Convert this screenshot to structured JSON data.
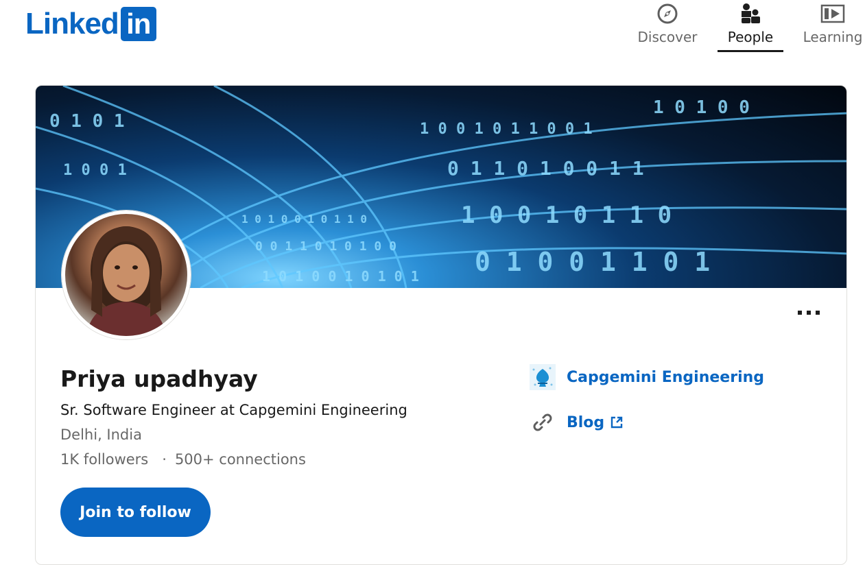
{
  "brand": {
    "logo_word": "Linked",
    "logo_box": "in",
    "color": "#0a66c2"
  },
  "nav": {
    "items": [
      {
        "label": "Discover",
        "icon": "compass-icon",
        "active": false
      },
      {
        "label": "People",
        "icon": "people-icon",
        "active": true
      },
      {
        "label": "Learning",
        "icon": "video-icon",
        "active": false
      }
    ]
  },
  "profile": {
    "name": "Priya upadhyay",
    "headline": "Sr. Software Engineer at Capgemini Engineering",
    "location": "Delhi, India",
    "followers": "1K followers",
    "separator": "·",
    "connections": "500+ connections",
    "cta_label": "Join to follow",
    "more_icon": "more-horizontal-icon",
    "banner_image": "binary-code-tunnel",
    "avatar_image": "profile-photo"
  },
  "sidebar": {
    "company": {
      "label": "Capgemini Engineering",
      "icon": "company-logo-icon"
    },
    "blog": {
      "label": "Blog",
      "icon": "link-icon",
      "external_icon": "external-link-icon"
    }
  },
  "colors": {
    "accent": "#0a66c2",
    "text_primary": "#000000e6",
    "text_secondary": "#00000099",
    "border": "#e0dfdc"
  }
}
